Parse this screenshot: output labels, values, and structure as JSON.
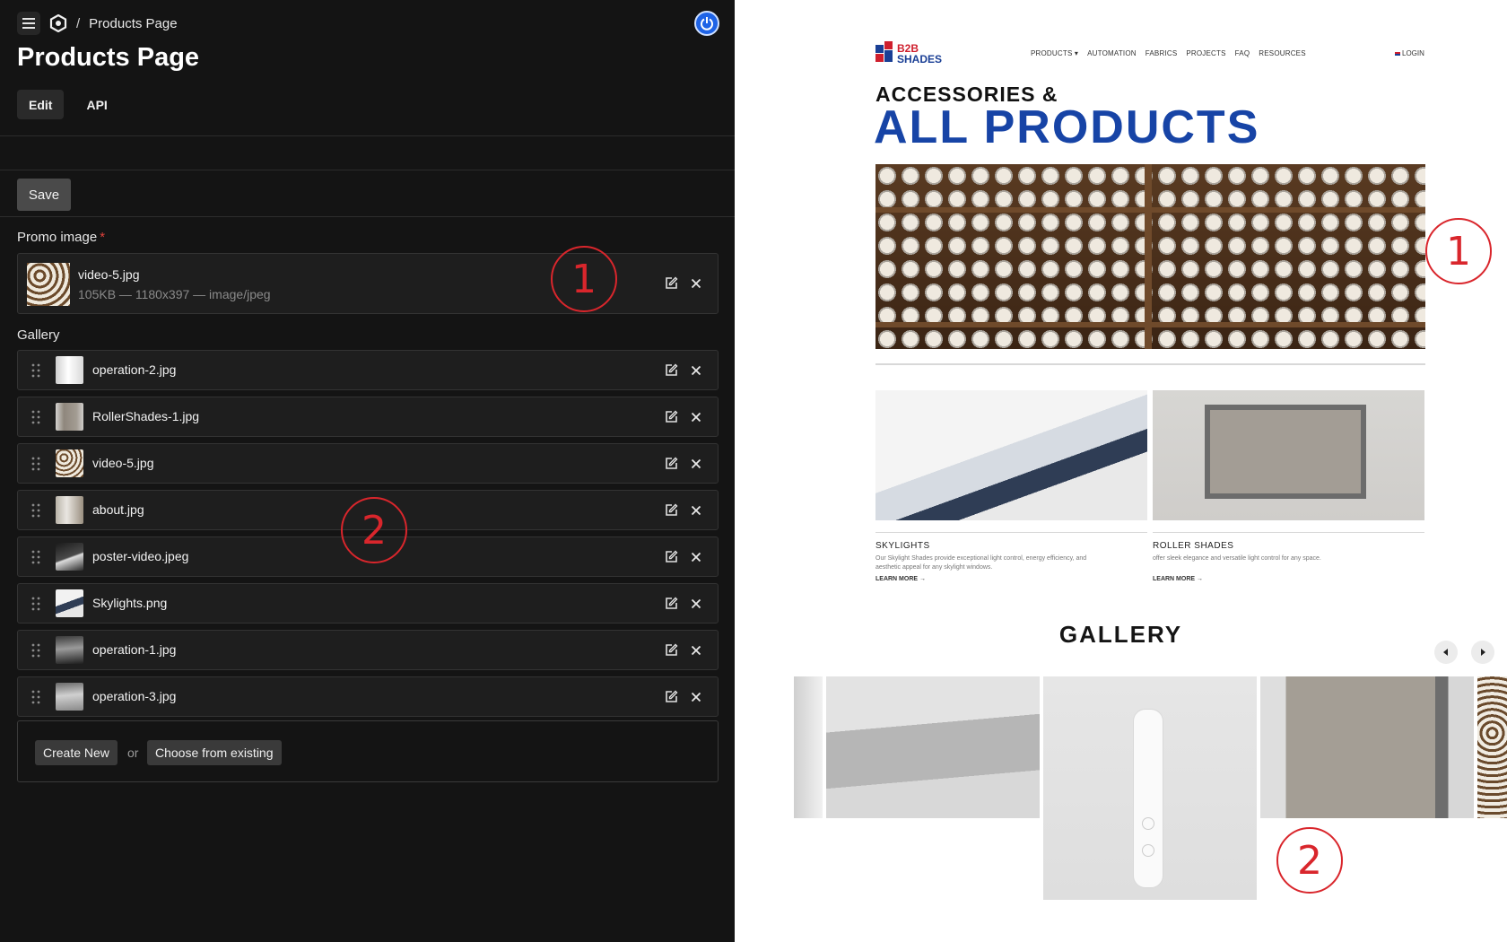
{
  "cms": {
    "breadcrumb": {
      "separator": "/",
      "current": "Products Page"
    },
    "page_title": "Products Page",
    "tabs": [
      {
        "label": "Edit",
        "active": true
      },
      {
        "label": "API",
        "active": false
      }
    ],
    "save_label": "Save",
    "promo": {
      "label": "Promo image",
      "required_mark": "*",
      "file_name": "video-5.jpg",
      "file_meta": "105KB — 1180x397 — image/jpeg"
    },
    "gallery": {
      "label": "Gallery",
      "items": [
        {
          "name": "operation-2.jpg"
        },
        {
          "name": "RollerShades-1.jpg"
        },
        {
          "name": "video-5.jpg"
        },
        {
          "name": "about.jpg"
        },
        {
          "name": "poster-video.jpeg"
        },
        {
          "name": "Skylights.png"
        },
        {
          "name": "operation-1.jpg"
        },
        {
          "name": "operation-3.jpg"
        }
      ]
    },
    "create_new_label": "Create New",
    "or_label": "or",
    "choose_existing_label": "Choose from existing",
    "colors": {
      "background": "#141414",
      "accent": "#1e63e6",
      "required": "#e0413b"
    }
  },
  "annotations": {
    "one": "1",
    "two": "2",
    "color": "#d9262c"
  },
  "site": {
    "brand": {
      "line1": "B2B",
      "line2": "SHADES"
    },
    "nav": [
      "PRODUCTS ▾",
      "AUTOMATION",
      "FABRICS",
      "PROJECTS",
      "FAQ",
      "RESOURCES"
    ],
    "login": "LOGIN",
    "heading_small": "ACCESSORIES &",
    "heading_large": "ALL PRODUCTS",
    "cards": [
      {
        "title": "SKYLIGHTS",
        "desc": "Our Skylight Shades provide exceptional light control, energy efficiency, and aesthetic appeal for any skylight windows.",
        "link": "LEARN MORE →"
      },
      {
        "title": "ROLLER SHADES",
        "desc": "offer sleek elegance and versatile light control for any space.",
        "link": "LEARN MORE →"
      }
    ],
    "gallery_title": "GALLERY",
    "colors": {
      "brand_blue": "#1744a6",
      "brand_red": "#cf1f2d"
    }
  }
}
